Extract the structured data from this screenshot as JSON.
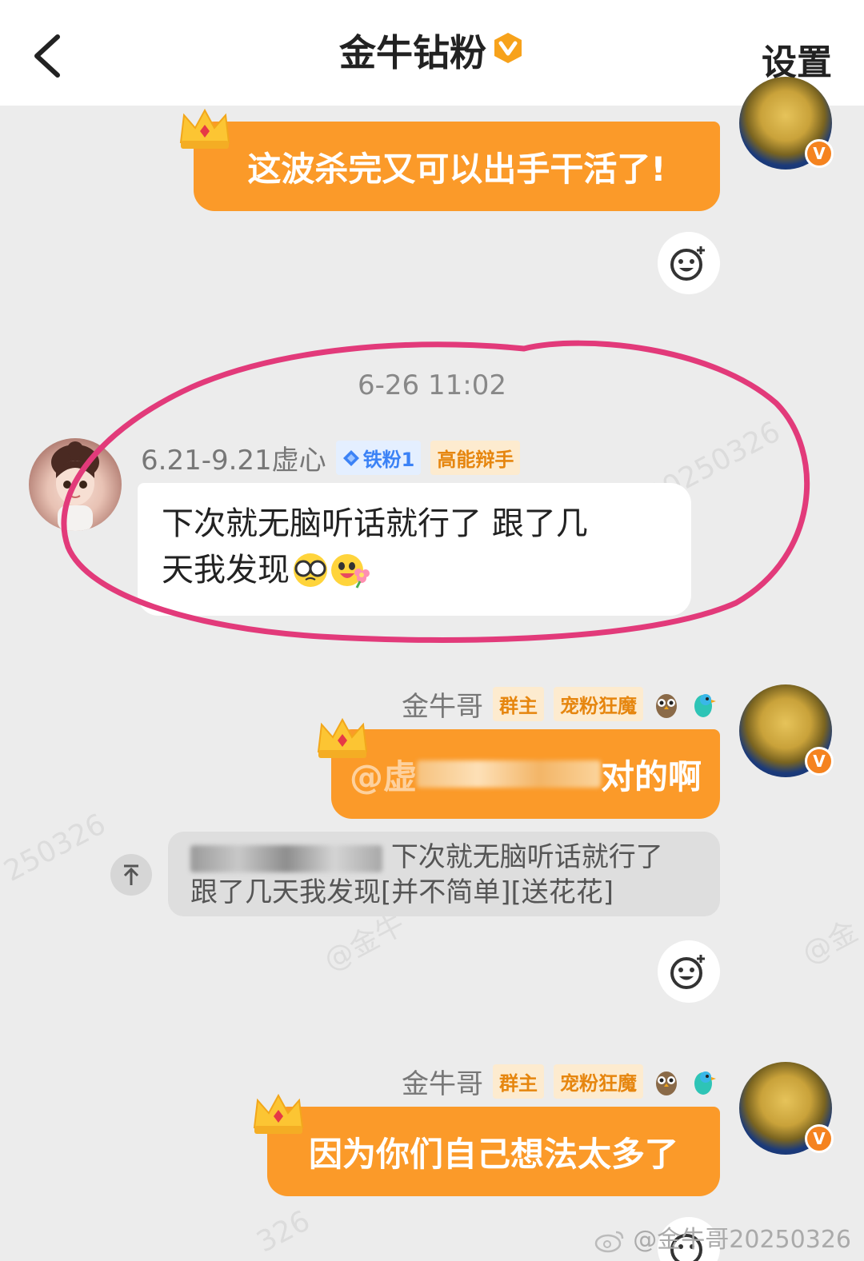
{
  "header": {
    "title": "金牛钻粉",
    "settings_label": "设置"
  },
  "messages": {
    "m1": {
      "text": "这波杀完又可以出手干活了!"
    },
    "timestamp": "6-26 11:02",
    "m2": {
      "sender": "6.21-9.21虚心",
      "tag1": "铁粉1",
      "tag2": "高能辩手",
      "text_line1": "下次就无脑听话就行了 跟了几",
      "text_line2": "天我发现"
    },
    "m3": {
      "sender": "金牛哥",
      "tag1": "群主",
      "tag2": "宠粉狂魔",
      "text_prefix": "@虚",
      "text_suffix": "对的啊",
      "quote_line1": "下次就无脑听话就行了",
      "quote_line2": "跟了几天我发现[并不简单][送花花]"
    },
    "m4": {
      "sender": "金牛哥",
      "tag1": "群主",
      "tag2": "宠粉狂魔",
      "text": "因为你们自己想法太多了"
    }
  },
  "watermark": "@金牛哥20250326",
  "icons": {
    "back": "chevron-left-icon",
    "verified": "verified-v-icon",
    "react": "emoji-add-icon",
    "upload": "arrow-up-icon",
    "crown": "crown-icon"
  },
  "colors": {
    "bubble_out": "#fb9a29",
    "highlight_circle": "#e23a7a",
    "tag_orange": "#e6860f",
    "tag_blue": "#3b82f6"
  }
}
